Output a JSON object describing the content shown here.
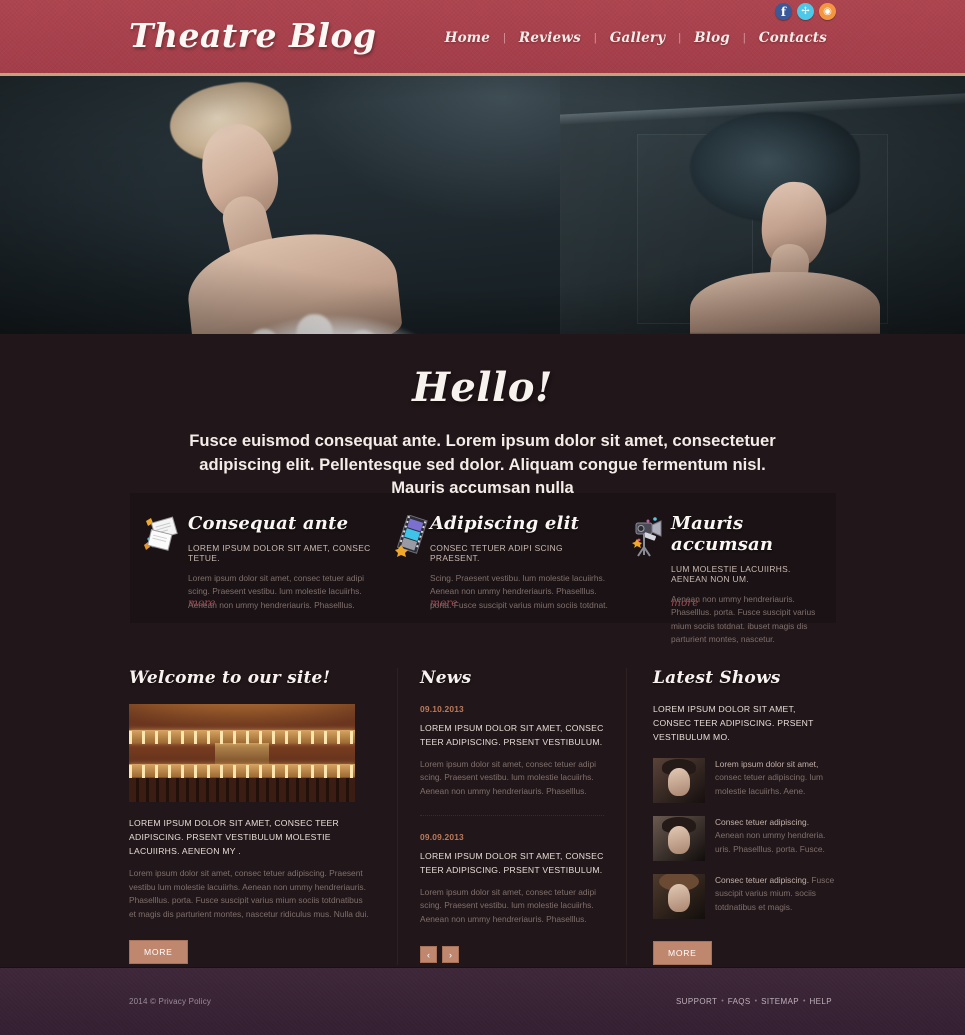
{
  "site": {
    "logo": "Theatre Blog"
  },
  "header": {
    "nav": [
      {
        "label": "Home"
      },
      {
        "label": "Reviews"
      },
      {
        "label": "Gallery"
      },
      {
        "label": "Blog"
      },
      {
        "label": "Contacts"
      }
    ],
    "nav_separator": "|",
    "social": [
      {
        "name": "facebook-icon",
        "glyph": "f",
        "color": "#3b5998"
      },
      {
        "name": "twitter-icon",
        "glyph": "✉",
        "color": "#4cc8e8"
      },
      {
        "name": "rss-icon",
        "glyph": "◠",
        "color": "#f49640"
      }
    ]
  },
  "intro": {
    "heading": "Hello!",
    "paragraph": "Fusce euismod consequat ante. Lorem ipsum dolor sit amet, consectetuer adipiscing elit. Pellentesque sed dolor. Aliquam congue fermentum nisl. Mauris accumsan nulla"
  },
  "features": [
    {
      "icon": "papers-icon",
      "title": "Consequat ante",
      "subtitle": "LOREM IPSUM DOLOR SIT AMET, CONSEC TETUE.",
      "body": "Lorem ipsum dolor sit amet, consec tetuer adipi scing. Praesent vestibu.  lum molestie lacuiirhs. Aenean non ummy hendreriauris. Phaselllus.",
      "more": "more"
    },
    {
      "icon": "filmstrip-icon",
      "title": "Adipiscing elit",
      "subtitle": "CONSEC TETUER ADIPI SCING PRAESENT.",
      "body": "Scing. Praesent vestibu.  lum molestie lacuiirhs. Aenean non ummy hendreriauris. Phaselllus. porta. Fusce suscipit varius mium sociis totdnat.",
      "more": "more"
    },
    {
      "icon": "camera-icon",
      "title": "Mauris accumsan",
      "subtitle": "LUM MOLESTIE LACUIIRHS. AENEAN NON UM.",
      "body": "Aenean non ummy hendreriauris. Phaselllus. porta. Fusce suscipit varius mium sociis totdnat. ibuset magis dis parturient montes, nascetur.",
      "more": "more"
    }
  ],
  "welcome": {
    "title": "Welcome  to our site!",
    "image_alt": "theatre-interior-photo",
    "headline": "LOREM IPSUM DOLOR SIT AMET, CONSEC TEER ADIPISCING. PRSENT VESTIBULUM MOLESTIE LACUIIRHS. AENEON MY .",
    "body": "Lorem ipsum dolor sit amet, consec tetuer adipiscing. Praesent vestibu lum molestie lacuiirhs. Aenean non ummy hendreriauris. Phaselllus. porta. Fusce suscipit varius mium sociis totdnatibus et magis dis parturient montes, nascetur ridiculus mus. Nulla dui.",
    "button": "MORE"
  },
  "news": {
    "title": "News",
    "items": [
      {
        "date": "09.10.2013",
        "title": "LOREM IPSUM DOLOR SIT AMET, CONSEC TEER ADIPISCING. PRSENT VESTIBULUM.",
        "body": "Lorem ipsum dolor sit amet, consec tetuer adipi scing. Praesent vestibu.  lum molestie lacuiirhs. Aenean non ummy hendreriauris. Phaselllus."
      },
      {
        "date": "09.09.2013",
        "title": "LOREM IPSUM DOLOR SIT AMET, CONSEC TEER ADIPISCING. PRSENT VESTIBULUM.",
        "body": "Lorem ipsum dolor sit amet, consec tetuer adipi scing. Praesent vestibu.  lum molestie lacuiirhs. Aenean non ummy hendreriauris. Phaselllus."
      }
    ],
    "pager": {
      "prev": "‹",
      "next": "›"
    }
  },
  "latest_shows": {
    "title": "Latest Shows",
    "intro": "LOREM IPSUM DOLOR SIT AMET, CONSEC TEER ADIPISCING. PRSENT VESTIBULUM MO.",
    "items": [
      {
        "thumb_alt": "show-thumbnail-1",
        "lead": "Lorem ipsum dolor sit amet,",
        "rest": "consec tetuer adipiscing. lum molestie lacuiirhs. Aene."
      },
      {
        "thumb_alt": "show-thumbnail-2",
        "lead": "Consec tetuer adipiscing.",
        "rest": "Aenean non ummy hendreria. uris. Phaselllus. porta. Fusce."
      },
      {
        "thumb_alt": "show-thumbnail-3",
        "lead": "Consec tetuer adipiscing.",
        "rest": "Fusce suscipit varius mium. sociis totdnatibus et magis."
      }
    ],
    "button": "MORE"
  },
  "footer": {
    "copyright": "2014 © Privacy Policy",
    "links": [
      {
        "label": "SUPPORT"
      },
      {
        "label": "FAQS"
      },
      {
        "label": "SITEMAP"
      },
      {
        "label": "HELP"
      }
    ],
    "separator": "•"
  },
  "colors": {
    "header_red": "#a8414d",
    "accent_gold": "#c9a07c",
    "dark_bg": "#211619",
    "panel_bg": "#1a1214",
    "button_salmon": "#c0876f",
    "footer_purple": "#3a2436",
    "link_red": "#9e4a52",
    "date_copper": "#bd7a58"
  }
}
